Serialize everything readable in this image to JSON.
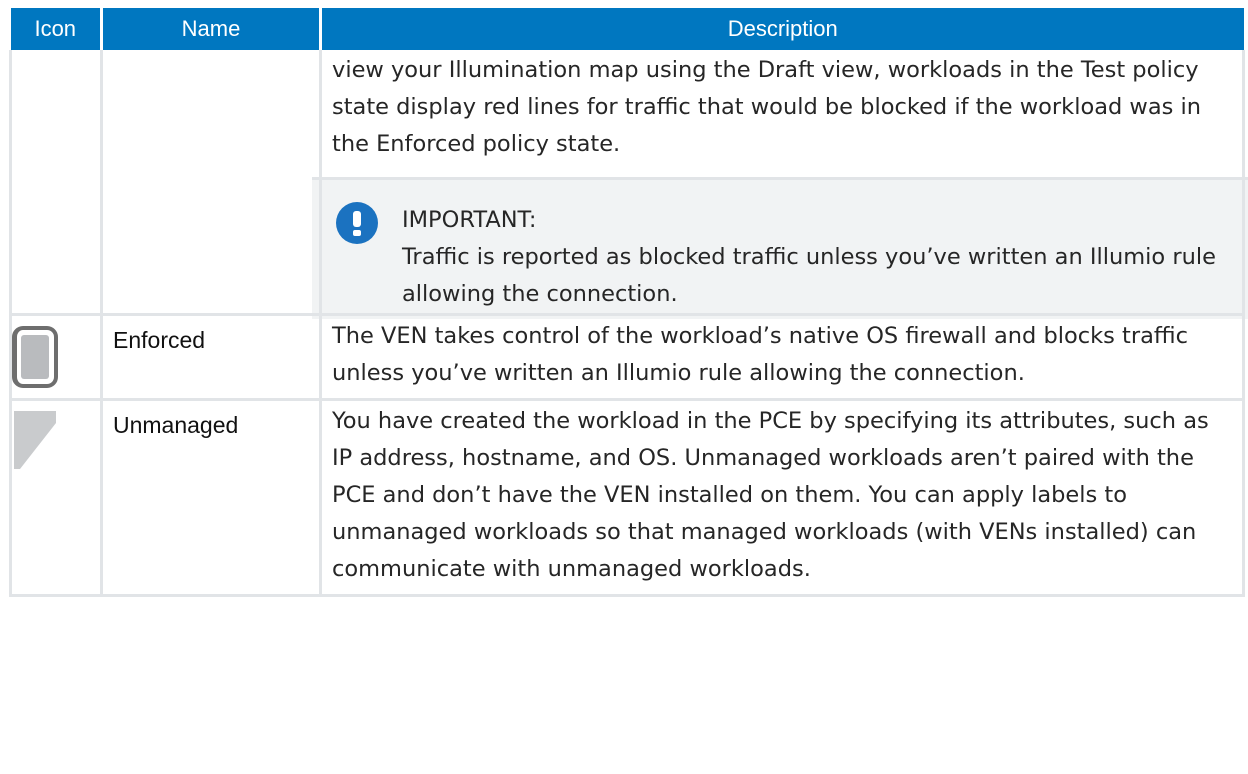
{
  "table": {
    "headers": {
      "icon": "Icon",
      "name": "Name",
      "description": "Description"
    },
    "continued_row": {
      "description": "view your Illumination map using the Draft view, workloads in the Test policy state display red lines for traffic that would be blocked if the workload was in the Enforced policy state.",
      "callout": {
        "icon": "exclamation-icon",
        "title": "IMPORTANT:",
        "text": "Traffic is reported as blocked traffic unless you’ve written an Illumio rule allowing the connection."
      }
    },
    "rows": [
      {
        "icon": "enforced-workload-icon",
        "name": "Enforced",
        "description": "The VEN takes control of the workload’s native OS firewall and blocks traffic unless you’ve written an Illumio rule allowing the connection."
      },
      {
        "icon": "unmanaged-workload-icon",
        "name": "Unmanaged",
        "description": "You have created the workload in the PCE by specifying its attributes, such as IP address, hostname, and OS. Unmanaged workloads aren’t paired with the PCE and don’t have the VEN installed on them. You can apply labels to unmanaged work­loads so that managed workloads (with VENs installed) can communicate with unmanaged workloads."
      }
    ]
  },
  "colors": {
    "header_bg": "#0077c0",
    "callout_badge": "#1b72c0",
    "border": "#e1e4e7"
  }
}
